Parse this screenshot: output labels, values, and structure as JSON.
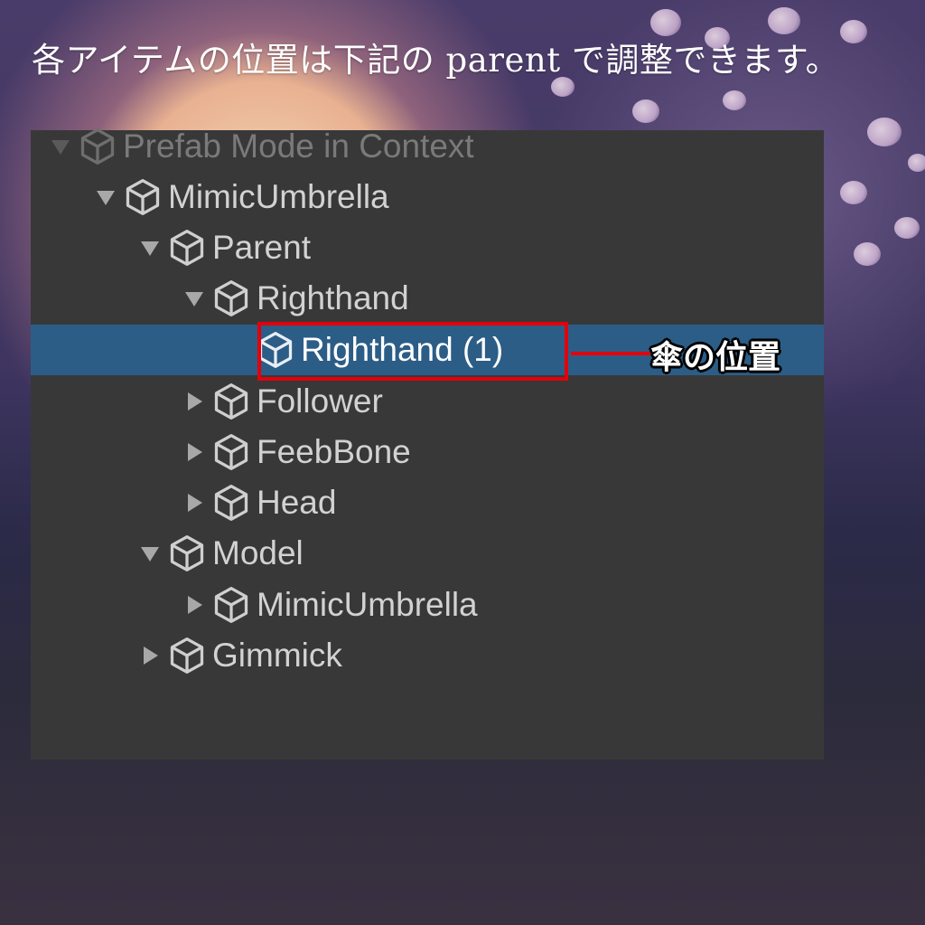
{
  "caption": "各アイテムの位置は下記の parent で調整できます。",
  "callout": {
    "label": "傘の位置",
    "color": "#e3000b"
  },
  "hierarchy": {
    "items": [
      {
        "label": "Prefab Mode in Context",
        "expanded": true,
        "dim": true
      },
      {
        "label": "MimicUmbrella",
        "expanded": true
      },
      {
        "label": "Parent",
        "expanded": true
      },
      {
        "label": "Righthand",
        "expanded": true
      },
      {
        "label": "Righthand (1)",
        "selected": true
      },
      {
        "label": "Follower",
        "expanded": false
      },
      {
        "label": "FeebBone",
        "expanded": false
      },
      {
        "label": "Head",
        "expanded": false
      },
      {
        "label": "Model",
        "expanded": true
      },
      {
        "label": "MimicUmbrella",
        "expanded": false
      },
      {
        "label": "Gimmick",
        "expanded": false
      }
    ]
  },
  "colors": {
    "panel": "#383838",
    "selection": "#2c5d87",
    "text": "#d2d2d2",
    "highlight_border": "#e3000b"
  }
}
